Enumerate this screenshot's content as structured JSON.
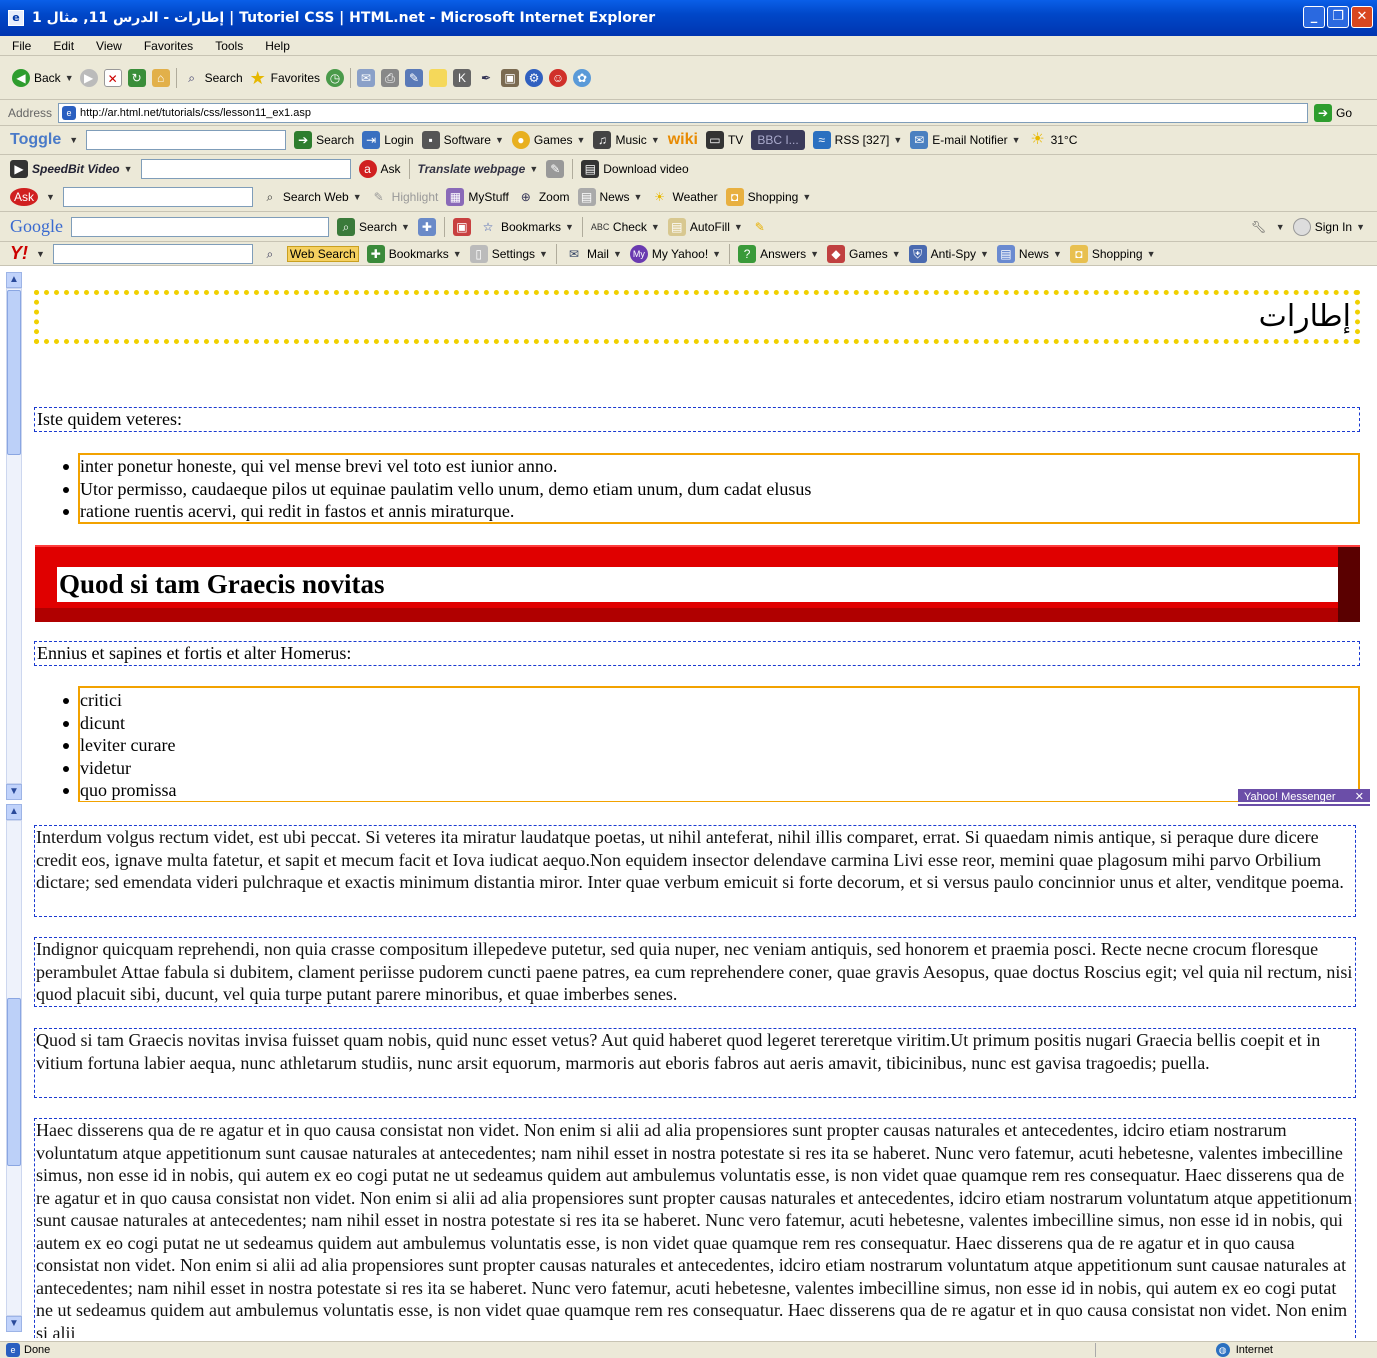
{
  "window": {
    "title": "إطارات - الدرس 11, مثال 1 | Tutoriel CSS | HTML.net - Microsoft Internet Explorer"
  },
  "menu": [
    "File",
    "Edit",
    "View",
    "Favorites",
    "Tools",
    "Help"
  ],
  "std_toolbar": {
    "back": "Back",
    "search": "Search",
    "favorites": "Favorites"
  },
  "address": {
    "label": "Address",
    "url": "http://ar.html.net/tutorials/css/lesson11_ex1.asp",
    "go": "Go"
  },
  "toggle_bar": {
    "brand": "Toggle",
    "search": "Search",
    "login": "Login",
    "software": "Software",
    "games": "Games",
    "music": "Music",
    "wiki": "wiki",
    "tv": "TV",
    "tuner": "BBC I...",
    "rss": "RSS [327]",
    "email": "E-mail Notifier",
    "temp": "31°C"
  },
  "speedbit_bar": {
    "brand": "SpeedBit Video",
    "ask": "Ask",
    "translate": "Translate webpage",
    "download": "Download video"
  },
  "ask_bar": {
    "search_web": "Search Web",
    "highlight": "Highlight",
    "mystuff": "MyStuff",
    "zoom": "Zoom",
    "news": "News",
    "weather": "Weather",
    "shopping": "Shopping"
  },
  "google_bar": {
    "brand": "Google",
    "search": "Search",
    "bookmarks": "Bookmarks",
    "check": "Check",
    "autofill": "AutoFill",
    "signin": "Sign In"
  },
  "yahoo_bar": {
    "brand": "Y!",
    "web_search": "Web Search",
    "bookmarks": "Bookmarks",
    "settings": "Settings",
    "mail": "Mail",
    "myyahoo": "My Yahoo!",
    "answers": "Answers",
    "games": "Games",
    "antispy": "Anti-Spy",
    "news": "News",
    "shopping": "Shopping"
  },
  "page": {
    "heading_ar": "إطارات",
    "intro1": "Iste quidem veteres:",
    "list1": [
      "inter ponetur honeste, qui vel mense brevi vel toto est iunior anno.",
      "Utor permisso, caudaeque pilos ut equinae paulatim vello unum, demo etiam unum, dum cadat elusus",
      "ratione ruentis acervi, qui redit in fastos et annis miraturque."
    ],
    "h2": "Quod si tam Graecis novitas",
    "intro2": "Ennius et sapines et fortis et alter Homerus:",
    "list2": [
      "critici",
      "dicunt",
      "leviter curare",
      "videtur",
      "quo promissa"
    ],
    "p1": "Interdum volgus rectum videt, est ubi peccat. Si veteres ita miratur laudatque poetas, ut nihil anteferat, nihil illis comparet, errat. Si quaedam nimis antique, si peraque dure dicere credit eos, ignave multa fatetur, et sapit et mecum facit et Iova iudicat aequo.Non equidem insector delendave carmina Livi esse reor, memini quae plagosum mihi parvo Orbilium dictare; sed emendata videri pulchraque et exactis minimum distantia miror. Inter quae verbum emicuit si forte decorum, et si versus paulo concinnior unus et alter, venditque poema.",
    "p2": "Indignor quicquam reprehendi, non quia crasse compositum illepedeve putetur, sed quia nuper, nec veniam antiquis, sed honorem et praemia posci. Recte necne crocum floresque perambulet Attae fabula si dubitem, clament periisse pudorem cuncti paene patres, ea cum reprehendere coner, quae gravis Aesopus, quae doctus Roscius egit; vel quia nil rectum, nisi quod placuit sibi, ducunt, vel quia turpe putant parere minoribus, et quae imberbes senes.",
    "p3": "Quod si tam Graecis novitas invisa fuisset quam nobis, quid nunc esset vetus? Aut quid haberet quod legeret tereretque viritim.Ut primum positis nugari Graecia bellis coepit et in vitium fortuna labier aequa, nunc athletarum studiis, nunc arsit equorum, marmoris aut eboris fabros aut aeris amavit, tibicinibus, nunc est gavisa tragoedis; puella.",
    "p4": "Haec disserens qua de re agatur et in quo causa consistat non videt. Non enim si alii ad alia propensiores sunt propter causas naturales et antecedentes, idciro etiam nostrarum voluntatum atque appetitionum sunt causae naturales at antecedentes; nam nihil esset in nostra potestate si res ita se haberet. Nunc vero fatemur, acuti hebetesne, valentes imbecilline simus, non esse id in nobis, qui autem ex eo cogi putat ne ut sedeamus quidem aut ambulemus voluntatis esse, is non videt quae quamque rem res consequatur. Haec disserens qua de re agatur et in quo causa consistat non videt. Non enim si alii ad alia propensiores sunt propter causas naturales et antecedentes, idciro etiam nostrarum voluntatum atque appetitionum sunt causae naturales at antecedentes; nam nihil esset in nostra potestate si res ita se haberet. Nunc vero fatemur, acuti hebetesne, valentes imbecilline simus, non esse id in nobis, qui autem ex eo cogi putat ne ut sedeamus quidem aut ambulemus voluntatis esse, is non videt quae quamque rem res consequatur. Haec disserens qua de re agatur et in quo causa consistat non videt. Non enim si alii ad alia propensiores sunt propter causas naturales et antecedentes, idciro etiam nostrarum voluntatum atque appetitionum sunt causae naturales at antecedentes; nam nihil esset in nostra potestate si res ita se haberet. Nunc vero fatemur, acuti hebetesne, valentes imbecilline simus, non esse id in nobis, qui autem ex eo cogi putat ne ut sedeamus quidem aut ambulemus voluntatis esse, is non videt quae quamque rem res consequatur. Haec disserens qua de re agatur et in quo causa consistat non videt. Non enim si alii"
  },
  "messenger": "Yahoo! Messenger",
  "status": {
    "left": "Done",
    "zone": "Internet"
  }
}
